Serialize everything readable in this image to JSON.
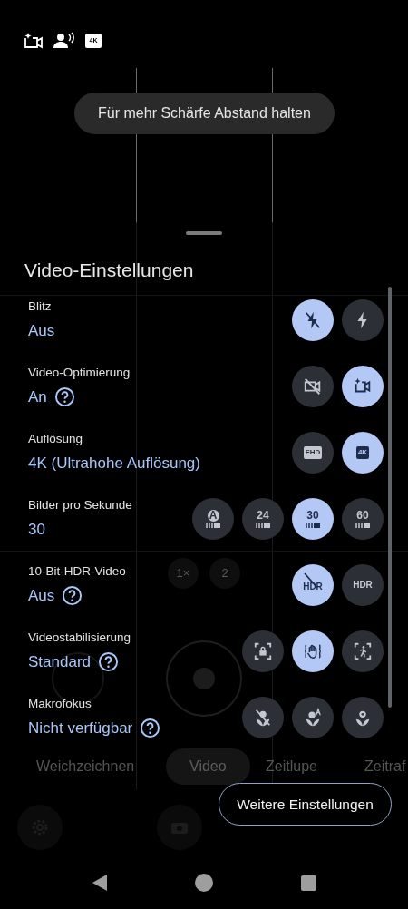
{
  "status_indicators": {
    "badge": "4K"
  },
  "toast": "Für mehr Schärfe Abstand halten",
  "panel": {
    "title": "Video-Einstellungen",
    "settings": [
      {
        "label": "Blitz",
        "value": "Aus",
        "help": false,
        "options": [
          {
            "kind": "icon",
            "selected": true
          },
          {
            "kind": "icon",
            "selected": false
          }
        ]
      },
      {
        "label": "Video-Optimierung",
        "value": "An",
        "help": true,
        "options": [
          {
            "kind": "icon",
            "selected": false
          },
          {
            "kind": "icon",
            "selected": true
          }
        ]
      },
      {
        "label": "Auflösung",
        "value": "4K (Ultrahohe Auflösung)",
        "help": false,
        "options": [
          {
            "kind": "badge",
            "label": "FHD",
            "selected": false
          },
          {
            "kind": "badge",
            "label": "4K",
            "selected": true
          }
        ]
      },
      {
        "label": "Bilder pro Sekunde",
        "value": "30",
        "help": false,
        "options": [
          {
            "kind": "fps-auto",
            "label": "A",
            "selected": false
          },
          {
            "kind": "fps",
            "label": "24",
            "selected": false
          },
          {
            "kind": "fps",
            "label": "30",
            "selected": true
          },
          {
            "kind": "fps",
            "label": "60",
            "selected": false
          }
        ]
      },
      {
        "label": "10-Bit-HDR-Video",
        "value": "Aus",
        "help": true,
        "options": [
          {
            "kind": "crossed",
            "label": "HDR",
            "selected": true
          },
          {
            "kind": "text",
            "label": "HDR",
            "selected": false
          }
        ]
      },
      {
        "label": "Videostabilisierung",
        "value": "Standard",
        "help": true,
        "options": [
          {
            "kind": "icon",
            "selected": false
          },
          {
            "kind": "icon",
            "selected": true
          },
          {
            "kind": "icon",
            "selected": false
          }
        ]
      },
      {
        "label": "Makrofokus",
        "value": "Nicht verfügbar",
        "help": true,
        "options": [
          {
            "kind": "icon",
            "selected": false
          },
          {
            "kind": "icon",
            "selected": false
          },
          {
            "kind": "icon",
            "selected": false
          }
        ]
      }
    ]
  },
  "more_settings_button": "Weitere Einstellungen",
  "background_camera": {
    "zoom_levels": [
      "1×",
      "2"
    ],
    "modes": [
      {
        "label": "Weichzeichnen",
        "selected": false
      },
      {
        "label": "Video",
        "selected": true
      },
      {
        "label": "Zeitlupe",
        "selected": false
      },
      {
        "label": "Zeitraf",
        "selected": false
      }
    ]
  }
}
